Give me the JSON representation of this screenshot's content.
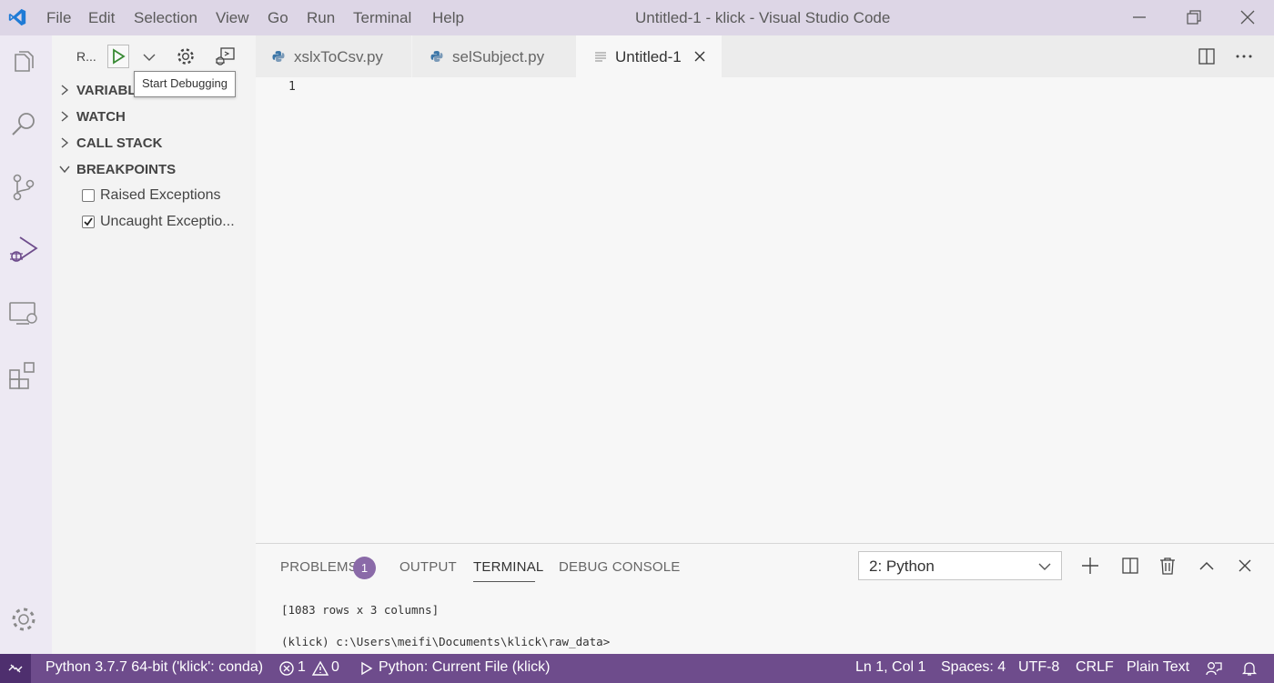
{
  "titlebar": {
    "menu": [
      "File",
      "Edit",
      "Selection",
      "View",
      "Go",
      "Run",
      "Terminal",
      "Help"
    ],
    "title": "Untitled-1 - klick - Visual Studio Code"
  },
  "sidebar": {
    "run_config": "R...",
    "tooltip": "Start Debugging",
    "sections": [
      "VARIABLES",
      "WATCH",
      "CALL STACK",
      "BREAKPOINTS"
    ],
    "breakpoints": [
      {
        "label": "Raised Exceptions",
        "checked": false
      },
      {
        "label": "Uncaught Exceptio...",
        "checked": true
      }
    ]
  },
  "tabs": [
    {
      "label": "xslxToCsv.py",
      "icon": "python-icon",
      "active": false
    },
    {
      "label": "selSubject.py",
      "icon": "python-icon",
      "active": false
    },
    {
      "label": "Untitled-1",
      "icon": "file-lines-icon",
      "active": true
    }
  ],
  "editor": {
    "line_numbers": [
      "1"
    ]
  },
  "panel": {
    "tabs": [
      "PROBLEMS",
      "OUTPUT",
      "TERMINAL",
      "DEBUG CONSOLE"
    ],
    "problems_count": "1",
    "active_tab": "TERMINAL",
    "terminal_select": "2: Python",
    "terminal_lines": [
      "[1083 rows x 3 columns]",
      "(klick) c:\\Users\\meifi\\Documents\\klick\\raw_data>"
    ]
  },
  "statusbar": {
    "interpreter": "Python 3.7.7 64-bit ('klick': conda)",
    "errors": "1",
    "warnings": "0",
    "launch": "Python: Current File (klick)",
    "position": "Ln 1, Col 1",
    "spaces": "Spaces: 4",
    "encoding": "UTF-8",
    "eol": "CRLF",
    "language": "Plain Text"
  },
  "colors": {
    "titlebar": "#ddd6e6",
    "statusbar": "#6e4c8c",
    "activitybar": "#ede9f3",
    "accent_green": "#388a34"
  }
}
